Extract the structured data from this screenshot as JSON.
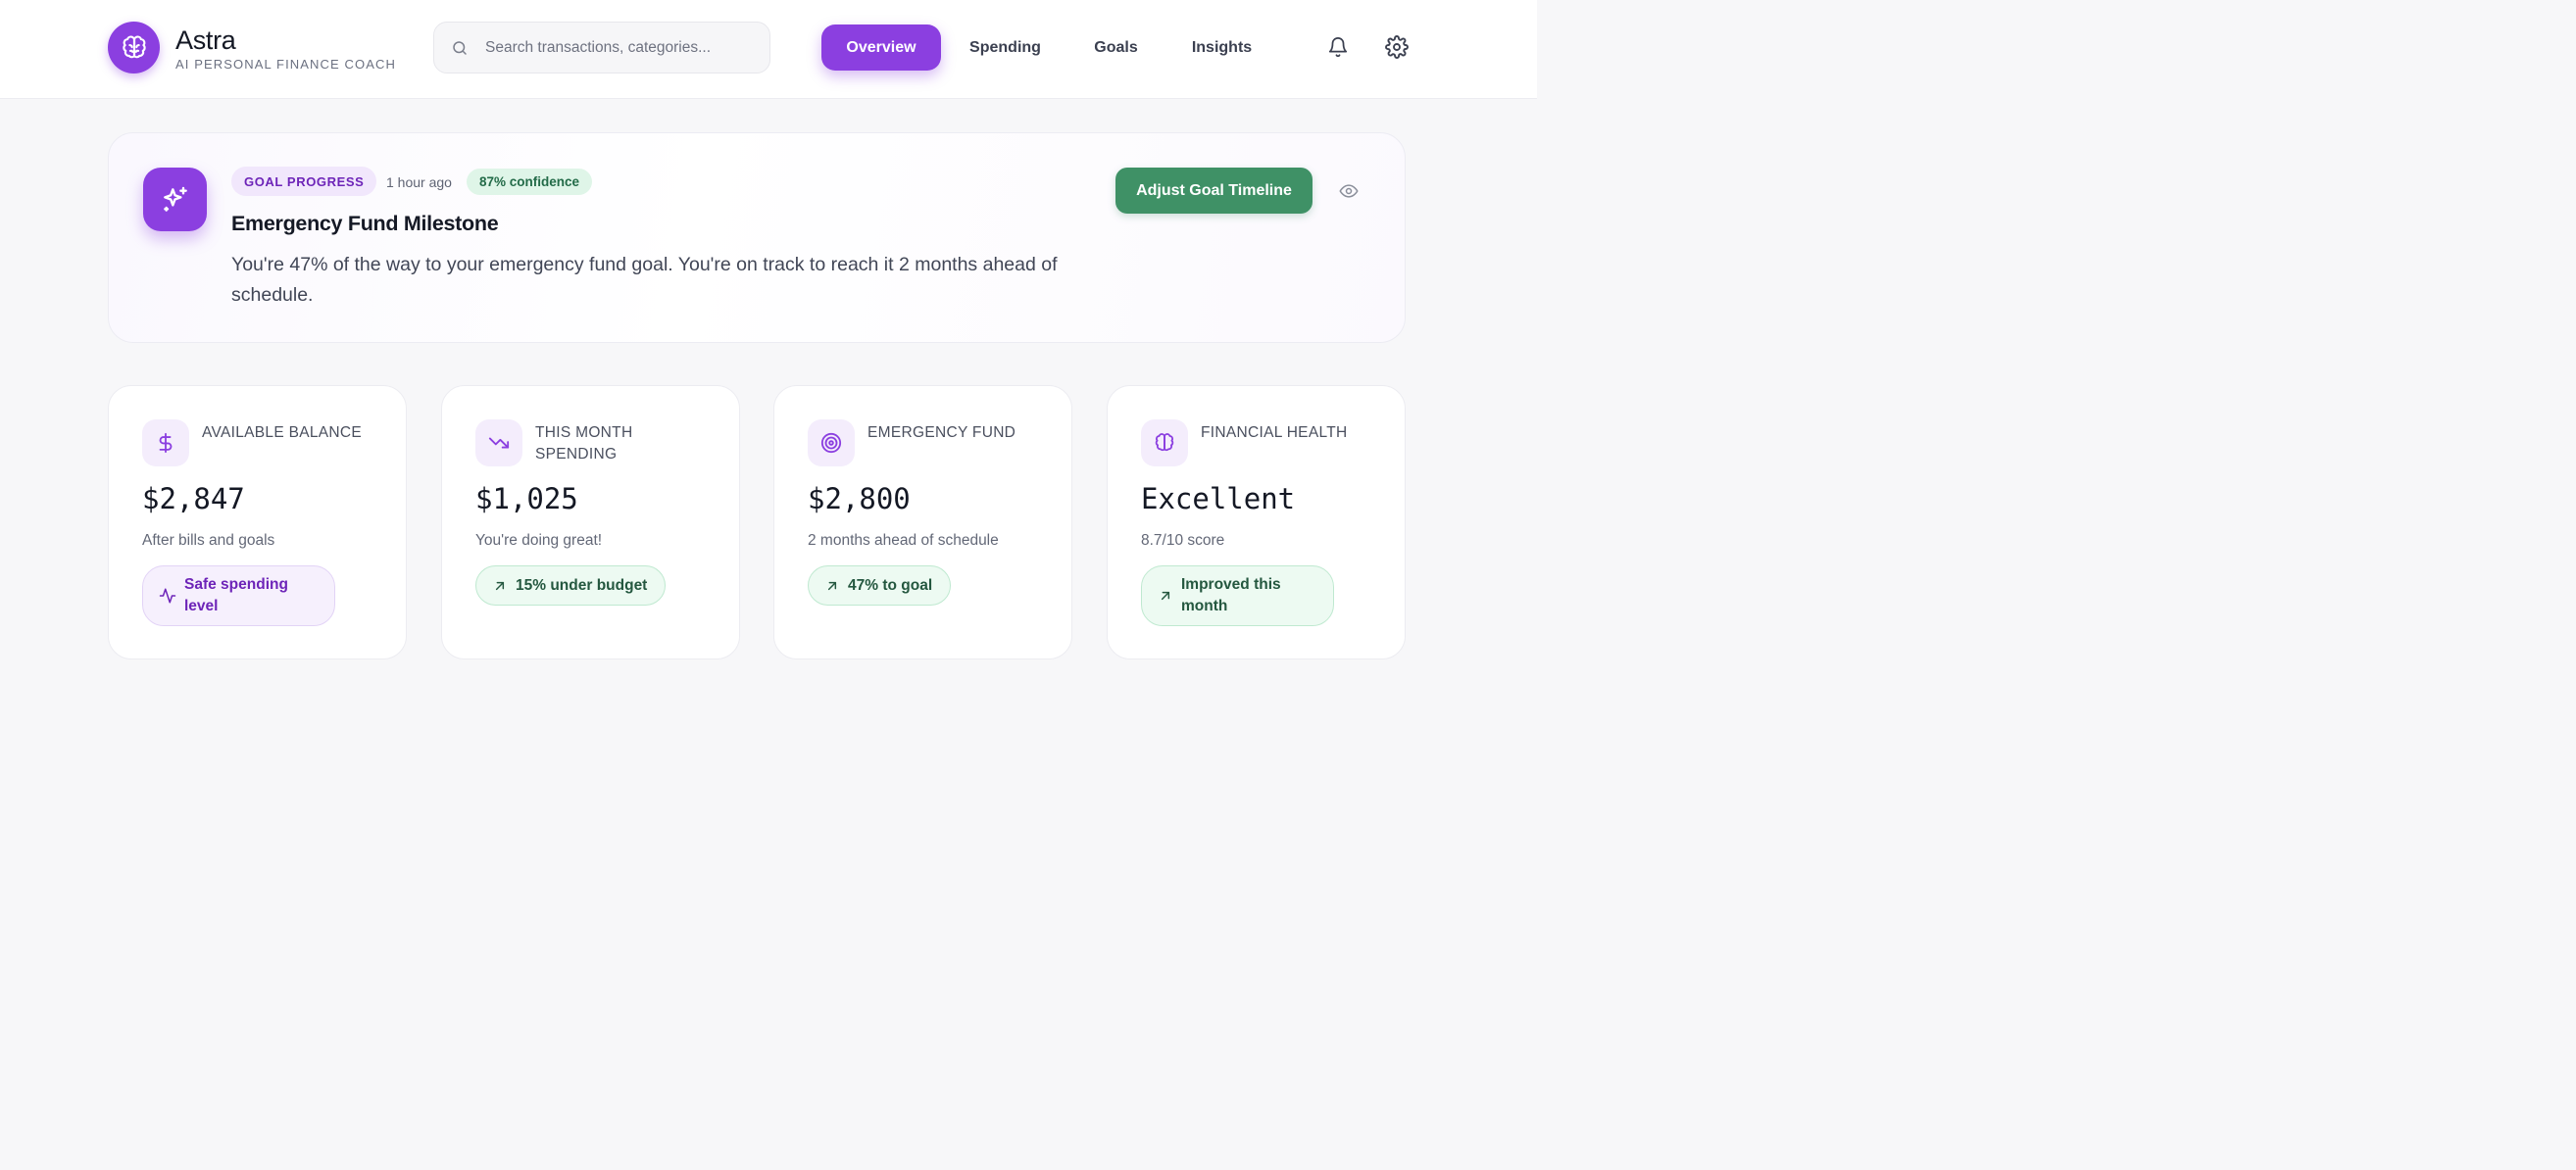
{
  "brand": {
    "name": "Astra",
    "tagline": "AI PERSONAL FINANCE COACH"
  },
  "search": {
    "placeholder": "Search transactions, categories...",
    "value": ""
  },
  "nav": {
    "items": [
      {
        "label": "Overview",
        "active": true
      },
      {
        "label": "Spending",
        "active": false
      },
      {
        "label": "Goals",
        "active": false
      },
      {
        "label": "Insights",
        "active": false
      }
    ],
    "icons": [
      "bell-icon",
      "gear-icon"
    ]
  },
  "insight": {
    "tag": "GOAL PROGRESS",
    "time": "1 hour ago",
    "confidence": "87% confidence",
    "title": "Emergency Fund Milestone",
    "body": "You're 47% of the way to your emergency fund goal. You're on track to reach it 2 months ahead of schedule.",
    "action_label": "Adjust Goal Timeline",
    "icon": "sparkles-icon"
  },
  "cards": [
    {
      "icon": "dollar-icon",
      "label": "AVAILABLE BALANCE",
      "value": "$2,847",
      "sub": "After bills and goals",
      "pill": "Safe spending level",
      "pill_icon": "activity-icon",
      "pill_style": "purple"
    },
    {
      "icon": "trending-down-icon",
      "label": "THIS MONTH SPENDING",
      "value": "$1,025",
      "sub": "You're doing great!",
      "pill": "15% under budget",
      "pill_icon": "arrow-up-right-icon",
      "pill_style": "green"
    },
    {
      "icon": "target-icon",
      "label": "EMERGENCY FUND",
      "value": "$2,800",
      "sub": "2 months ahead of schedule",
      "pill": "47% to goal",
      "pill_icon": "arrow-up-right-icon",
      "pill_style": "green"
    },
    {
      "icon": "brain-icon",
      "label": "FINANCIAL HEALTH",
      "value": "Excellent",
      "sub": "8.7/10 score",
      "pill": "Improved this month",
      "pill_icon": "arrow-up-right-icon",
      "pill_style": "green"
    }
  ],
  "colors": {
    "brand_purple": "#8b3fe0",
    "action_green": "#3f9166",
    "background": "#f7f7f9"
  }
}
